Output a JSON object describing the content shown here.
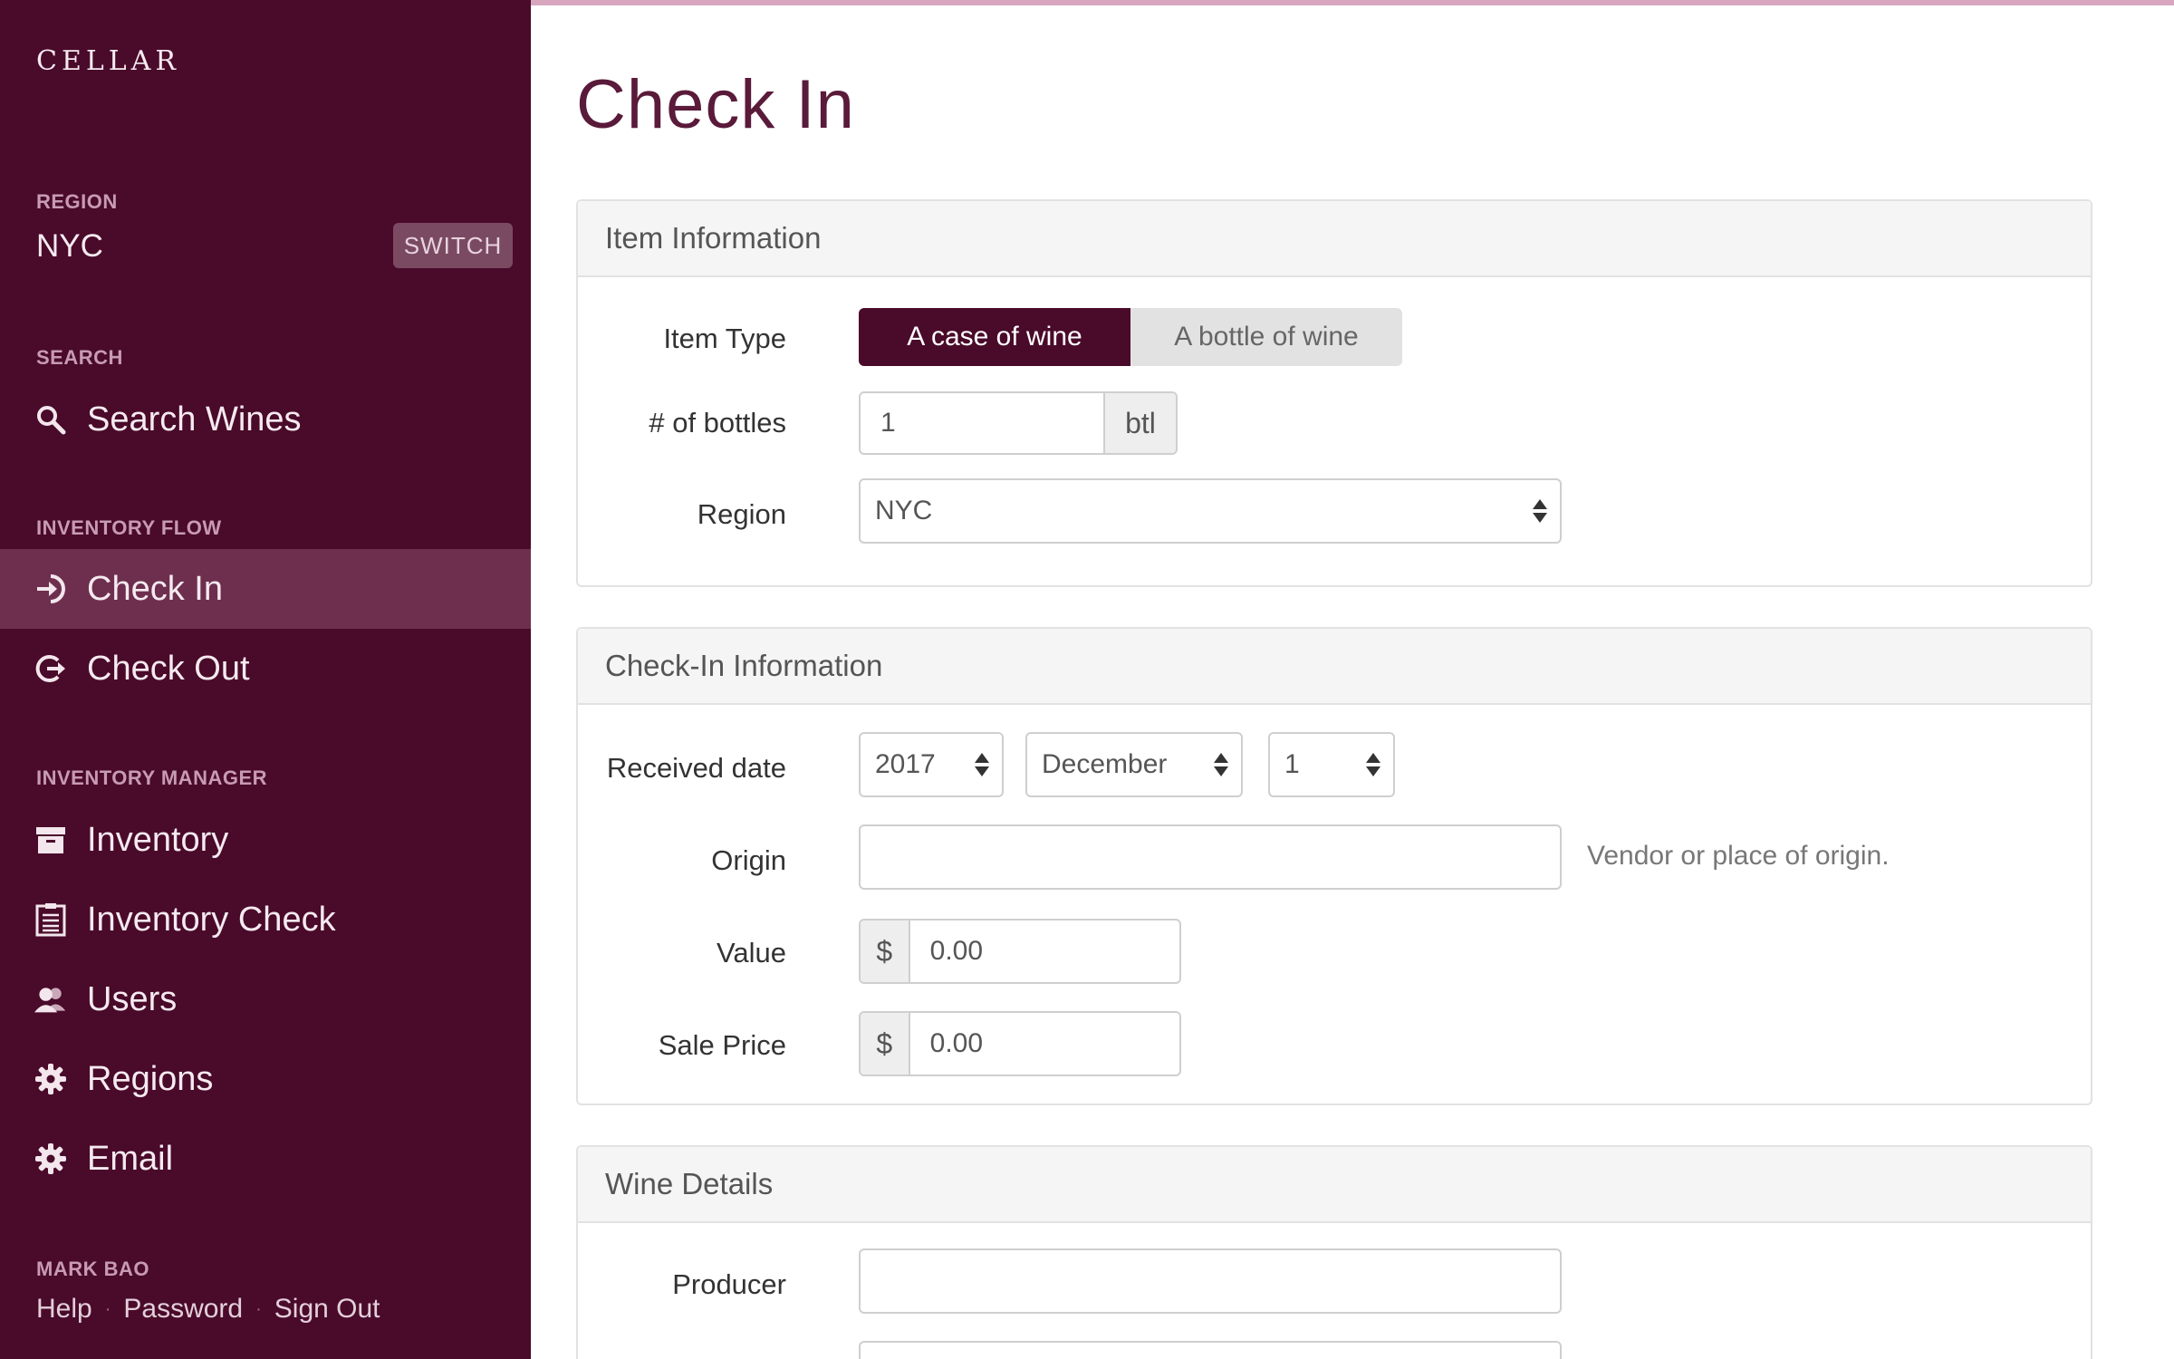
{
  "sidebar": {
    "brand": "CELLAR",
    "region_label": "REGION",
    "region_name": "NYC",
    "switch_label": "SWITCH",
    "search_label": "SEARCH",
    "search_item": "Search Wines",
    "flow_label": "INVENTORY FLOW",
    "check_in": "Check In",
    "check_out": "Check Out",
    "manager_label": "INVENTORY MANAGER",
    "inventory": "Inventory",
    "inventory_check": "Inventory Check",
    "users": "Users",
    "regions": "Regions",
    "email": "Email",
    "user_name": "MARK BAO",
    "help": "Help",
    "password": "Password",
    "sign_out": "Sign Out"
  },
  "page": {
    "title": "Check In"
  },
  "item_info": {
    "heading": "Item Information",
    "item_type_label": "Item Type",
    "type_case": "A case of wine",
    "type_bottle": "A bottle of wine",
    "bottles_label": "# of bottles",
    "bottles_value": "1",
    "bottles_unit": "btl",
    "region_label": "Region",
    "region_value": "NYC"
  },
  "checkin_info": {
    "heading": "Check-In Information",
    "received_label": "Received date",
    "year": "2017",
    "month": "December",
    "day": "1",
    "origin_label": "Origin",
    "origin_value": "",
    "origin_help": "Vendor or place of origin.",
    "value_label": "Value",
    "currency": "$",
    "value_value": "0.00",
    "sale_label": "Sale Price",
    "sale_value": "0.00"
  },
  "wine_details": {
    "heading": "Wine Details",
    "producer_label": "Producer",
    "producer_value": ""
  }
}
